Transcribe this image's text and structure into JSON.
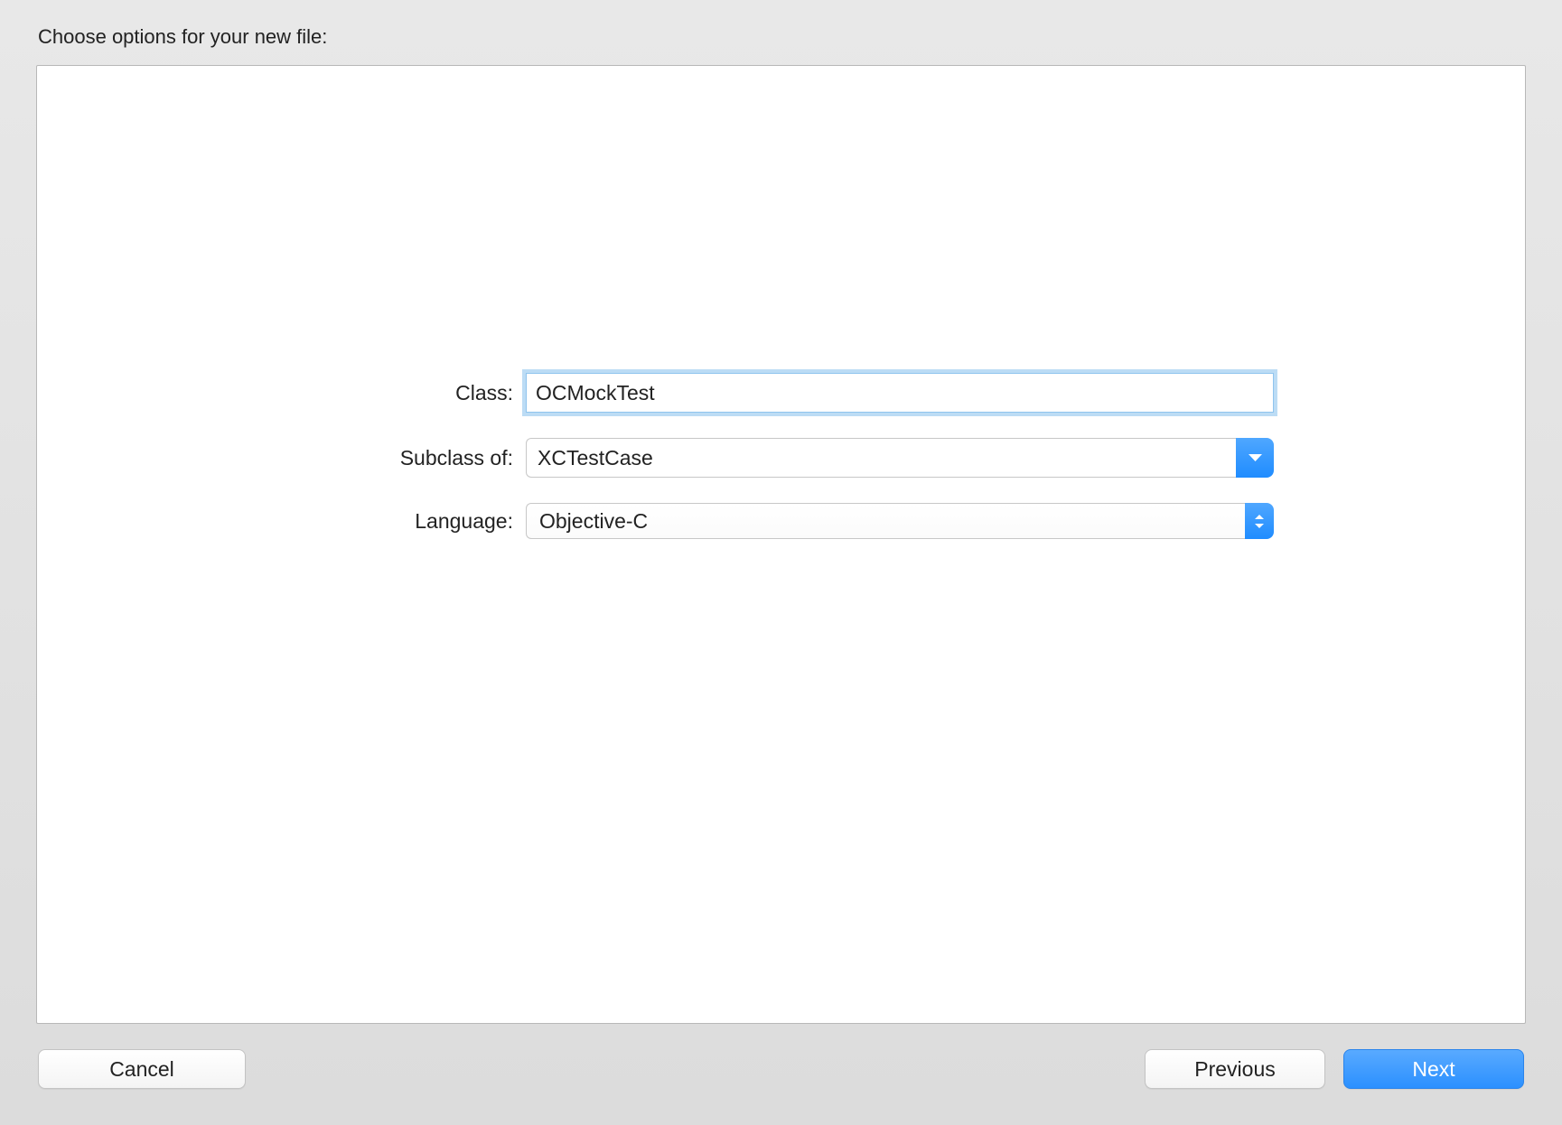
{
  "dialog": {
    "title": "Choose options for your new file:"
  },
  "form": {
    "class_label": "Class:",
    "class_value": "OCMockTest",
    "subclass_label": "Subclass of:",
    "subclass_value": "XCTestCase",
    "language_label": "Language:",
    "language_value": "Objective-C"
  },
  "buttons": {
    "cancel": "Cancel",
    "previous": "Previous",
    "next": "Next"
  },
  "colors": {
    "accent": "#2b90ff",
    "focus_ring": "#bcdcf5"
  }
}
